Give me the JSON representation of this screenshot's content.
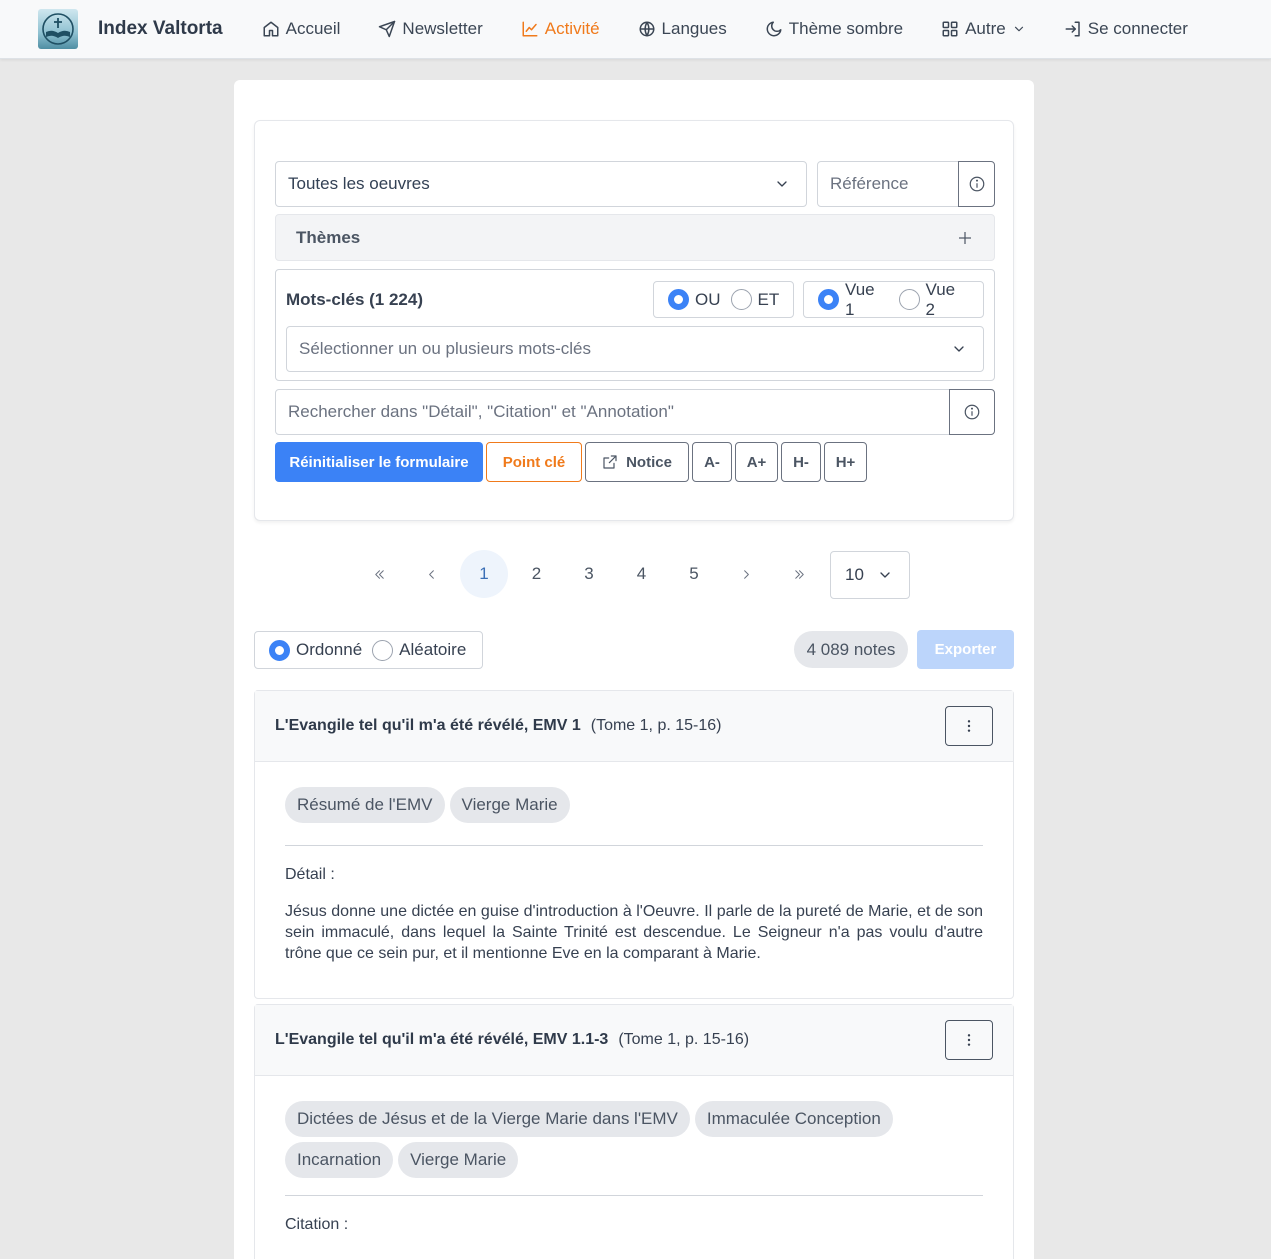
{
  "navbar": {
    "brand": "Index Valtorta",
    "items": [
      {
        "label": "Accueil",
        "icon": "home-icon"
      },
      {
        "label": "Newsletter",
        "icon": "send-icon"
      },
      {
        "label": "Activité",
        "icon": "chart-line-icon",
        "active": true
      },
      {
        "label": "Langues",
        "icon": "globe-icon"
      },
      {
        "label": "Thème sombre",
        "icon": "moon-icon"
      },
      {
        "label": "Autre",
        "icon": "grid-icon"
      },
      {
        "label": "Se connecter",
        "icon": "login-icon"
      }
    ],
    "accent_color": "#f07a1b"
  },
  "form": {
    "works_select": "Toutes les oeuvres",
    "reference_placeholder": "Référence",
    "themes_label": "Thèmes",
    "keywords_title": "Mots-clés (1 224)",
    "logic_or": "OU",
    "logic_and": "ET",
    "view1": "Vue 1",
    "view2": "Vue 2",
    "keywords_placeholder": "Sélectionner un ou plusieurs mots-clés",
    "search_placeholder": "Rechercher dans \"Détail\", \"Citation\" et \"Annotation\"",
    "buttons": {
      "reset": "Réinitialiser le formulaire",
      "keypoint": "Point clé",
      "notice": "Notice",
      "font_minus": "A-",
      "font_plus": "A+",
      "height_minus": "H-",
      "height_plus": "H+"
    },
    "primary_color": "#3b82f6"
  },
  "pagination": {
    "pages": [
      "1",
      "2",
      "3",
      "4",
      "5"
    ],
    "current": "1",
    "per_page": "10"
  },
  "results": {
    "order_ordered": "Ordonné",
    "order_random": "Aléatoire",
    "count": "4 089 notes",
    "export": "Exporter"
  },
  "notes": [
    {
      "title": "L'Evangile tel qu'il m'a été révélé, EMV 1",
      "ref": "(Tome 1, p. 15-16)",
      "tags": [
        "Résumé de l'EMV",
        "Vierge Marie"
      ],
      "field_label": "Détail :",
      "text": "Jésus donne une dictée en guise d'introduction à l'Oeuvre. Il parle de la pureté de Marie, et de son sein immaculé, dans lequel la Sainte Trinité est descendue. Le Seigneur n'a pas voulu d'autre trône que ce sein pur, et il mentionne Eve en la comparant à Marie."
    },
    {
      "title": "L'Evangile tel qu'il m'a été révélé, EMV 1.1-3",
      "ref": "(Tome 1, p. 15-16)",
      "tags": [
        "Dictées de Jésus et de la Vierge Marie dans l'EMV",
        "Immaculée Conception",
        "Incarnation",
        "Vierge Marie"
      ],
      "field_label": "Citation :",
      "text": ""
    }
  ]
}
